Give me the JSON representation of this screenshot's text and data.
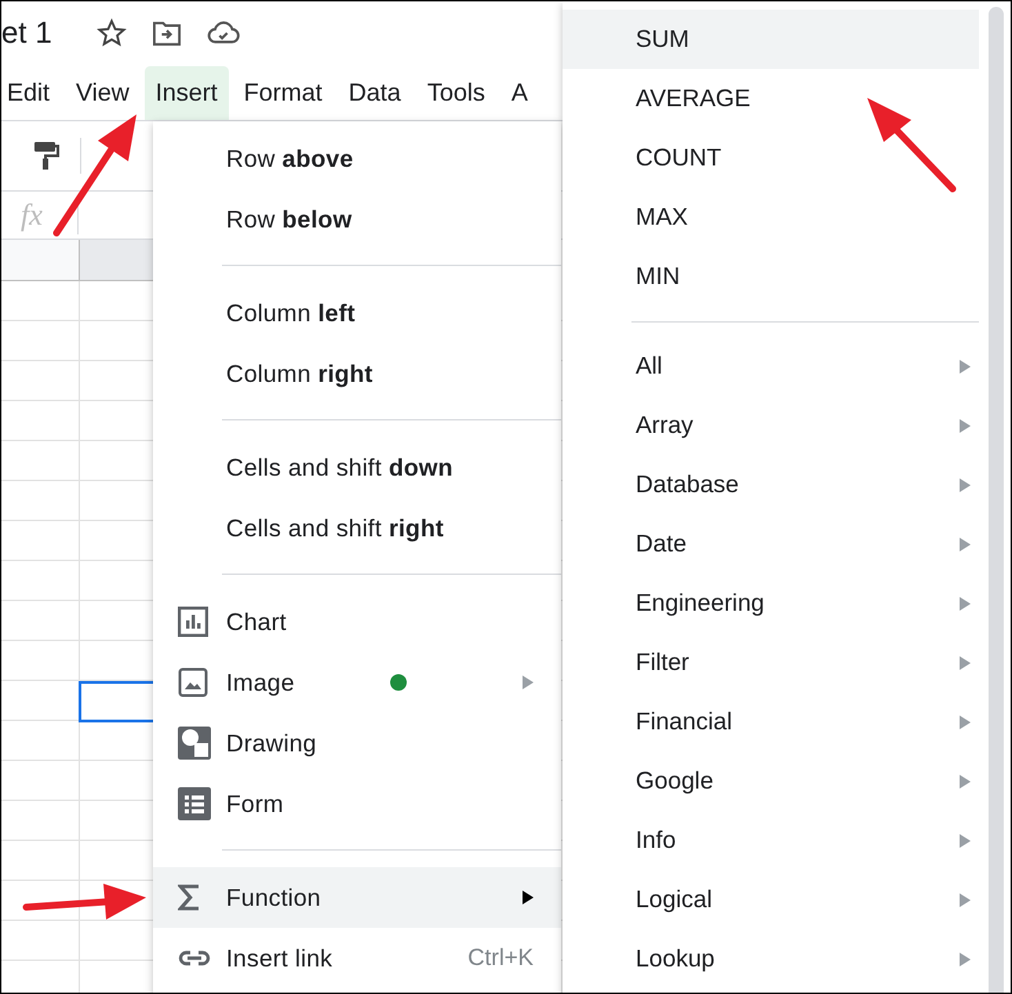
{
  "document": {
    "title": "et 1"
  },
  "menu_bar": [
    {
      "label": "Edit",
      "selected": false
    },
    {
      "label": "View",
      "selected": false
    },
    {
      "label": "Insert",
      "selected": true
    },
    {
      "label": "Format",
      "selected": false
    },
    {
      "label": "Data",
      "selected": false
    },
    {
      "label": "Tools",
      "selected": false
    },
    {
      "label": "A",
      "selected": false
    }
  ],
  "formula_bar": {
    "label": "fx"
  },
  "insert_menu": {
    "items": [
      {
        "kind": "item",
        "label": "Row **above**",
        "selected": false
      },
      {
        "kind": "item",
        "label": "Row **below**",
        "selected": false
      },
      {
        "kind": "divider"
      },
      {
        "kind": "item",
        "label": "Column **left**",
        "selected": false
      },
      {
        "kind": "item",
        "label": "Column **right**",
        "selected": false
      },
      {
        "kind": "divider"
      },
      {
        "kind": "item",
        "label": "Cells and shift **down**",
        "selected": false
      },
      {
        "kind": "item",
        "label": "Cells and shift **right**",
        "selected": false
      },
      {
        "kind": "divider"
      },
      {
        "kind": "icon_item",
        "label": "Chart",
        "selected": false
      },
      {
        "kind": "icon_item",
        "label": "Image",
        "selected": false,
        "badge": true,
        "submenu": true
      },
      {
        "kind": "icon_item",
        "label": "Drawing",
        "selected": false
      },
      {
        "kind": "icon_item",
        "label": "Form",
        "selected": false
      },
      {
        "kind": "divider"
      },
      {
        "kind": "icon_item",
        "label": "Function",
        "selected": true,
        "submenu": true
      },
      {
        "kind": "icon_item",
        "label": "Insert link",
        "selected": false,
        "shortcut": "Ctrl+K"
      }
    ]
  },
  "function_menu": {
    "items": [
      {
        "kind": "item",
        "label": "SUM",
        "selected": true
      },
      {
        "kind": "item",
        "label": "AVERAGE",
        "selected": false
      },
      {
        "kind": "item",
        "label": "COUNT",
        "selected": false
      },
      {
        "kind": "item",
        "label": "MAX",
        "selected": false
      },
      {
        "kind": "item",
        "label": "MIN",
        "selected": false
      },
      {
        "kind": "divider"
      },
      {
        "kind": "item",
        "label": "All",
        "selected": false,
        "submenu": true
      },
      {
        "kind": "item",
        "label": "Array",
        "selected": false,
        "submenu": true
      },
      {
        "kind": "item",
        "label": "Database",
        "selected": false,
        "submenu": true
      },
      {
        "kind": "item",
        "label": "Date",
        "selected": false,
        "submenu": true
      },
      {
        "kind": "item",
        "label": "Engineering",
        "selected": false,
        "submenu": true
      },
      {
        "kind": "item",
        "label": "Filter",
        "selected": false,
        "submenu": true
      },
      {
        "kind": "item",
        "label": "Financial",
        "selected": false,
        "submenu": true
      },
      {
        "kind": "item",
        "label": "Google",
        "selected": false,
        "submenu": true
      },
      {
        "kind": "item",
        "label": "Info",
        "selected": false,
        "submenu": true
      },
      {
        "kind": "item",
        "label": "Logical",
        "selected": false,
        "submenu": true
      },
      {
        "kind": "item",
        "label": "Lookup",
        "selected": false,
        "submenu": true
      }
    ]
  }
}
